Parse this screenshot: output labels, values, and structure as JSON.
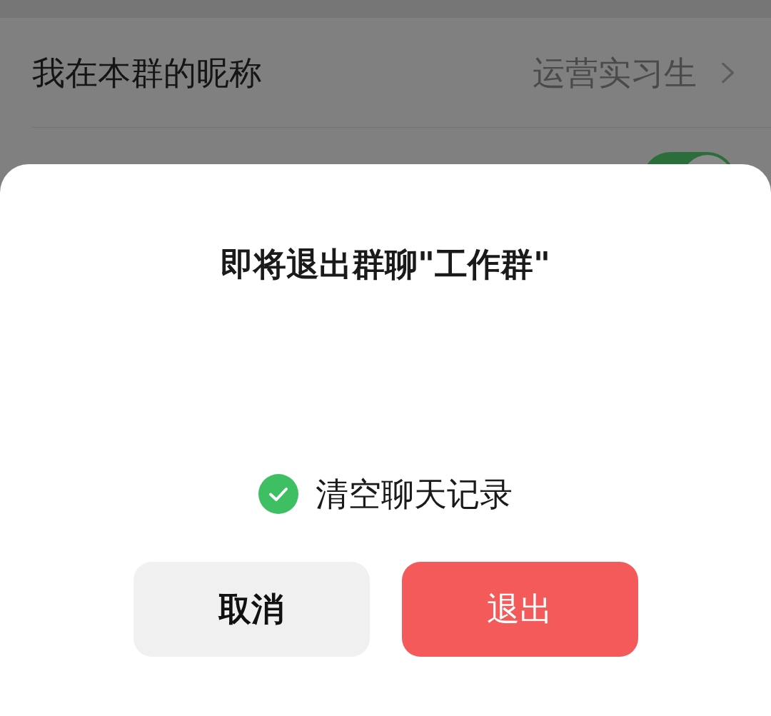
{
  "settings": {
    "nickname_row": {
      "label": "我在本群的昵称",
      "value": "运营实习生"
    },
    "toggle_row": {
      "on": true
    }
  },
  "dialog": {
    "title": "即将退出群聊\"工作群\"",
    "option": {
      "label": "清空聊天记录",
      "checked": true
    },
    "buttons": [
      {
        "label": "取消",
        "kind": "secondary"
      },
      {
        "label": "退出",
        "kind": "danger"
      }
    ]
  }
}
